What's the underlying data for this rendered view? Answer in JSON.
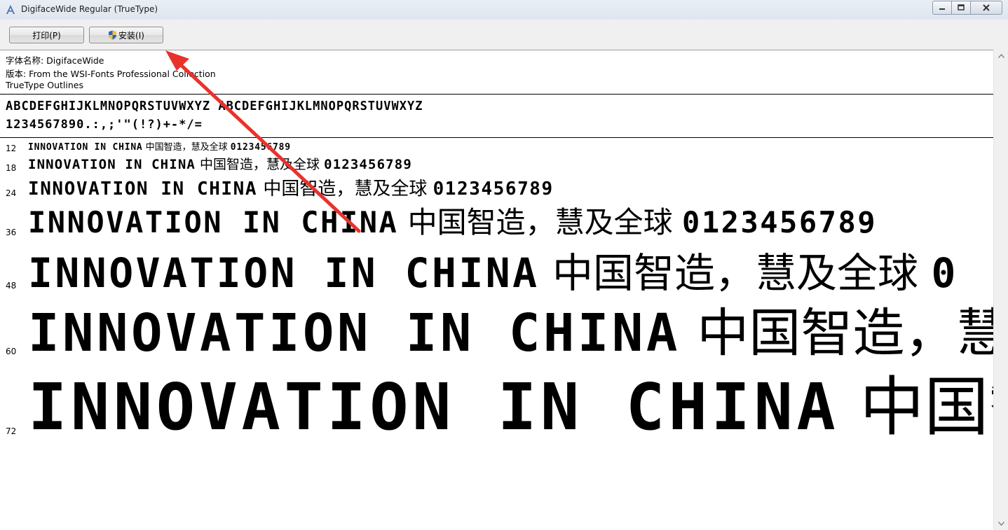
{
  "window": {
    "title": "DigifaceWide Regular (TrueType)",
    "app_icon": "font-viewer-icon",
    "buttons": {
      "minimize": "minimize-icon",
      "maximize": "maximize-icon",
      "close": "close-icon"
    }
  },
  "toolbar": {
    "print_label": "打印(P)",
    "install_label": "安装(I)",
    "install_icon": "uac-shield-icon"
  },
  "font_info": {
    "name_line": "字体名称: DigifaceWide",
    "version_line": "版本: From the WSI-Fonts Professional Collection",
    "outline_line": "TrueType Outlines"
  },
  "charset": {
    "alphabet": "ABCDEFGHIJKLMNOPQRSTUVWXYZ ABCDEFGHIJKLMNOPQRSTUVWXYZ",
    "digits_symbols": "1234567890.:,;'\"(!?)+-*/="
  },
  "samples": [
    {
      "size": "12",
      "latin": "INNOVATION IN CHINA",
      "cjk": " 中国智造，慧及全球 ",
      "digits": "0123456789"
    },
    {
      "size": "18",
      "latin": "INNOVATION IN CHINA",
      "cjk": " 中国智造，慧及全球 ",
      "digits": "0123456789"
    },
    {
      "size": "24",
      "latin": "INNOVATION IN CHINA",
      "cjk": " 中国智造，慧及全球 ",
      "digits": "0123456789"
    },
    {
      "size": "36",
      "latin": "INNOVATION IN CHINA",
      "cjk": " 中国智造，慧及全球 ",
      "digits": "0123456789"
    },
    {
      "size": "48",
      "latin": "INNOVATION IN CHINA",
      "cjk": " 中国智造，慧及全球 ",
      "digits": "0"
    },
    {
      "size": "60",
      "latin": "INNOVATION IN CHINA",
      "cjk": " 中国智造，慧",
      "digits": ""
    },
    {
      "size": "72",
      "latin": "INNOVATION IN CHINA",
      "cjk": " 中国智",
      "digits": ""
    }
  ],
  "annotation": {
    "color": "#e8322c"
  }
}
